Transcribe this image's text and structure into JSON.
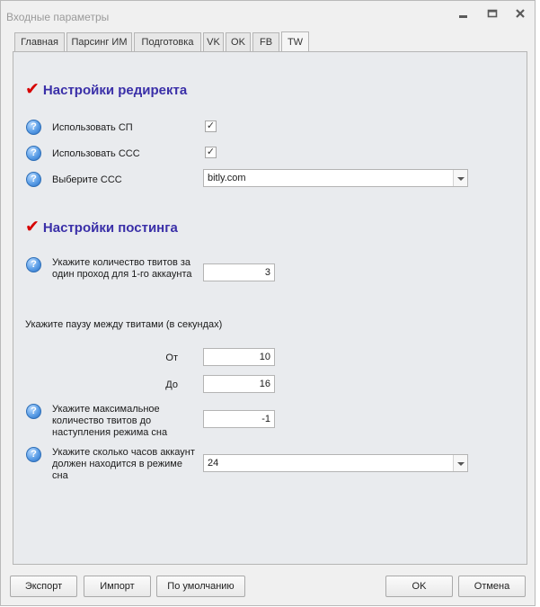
{
  "window": {
    "title": "Входные параметры"
  },
  "tabs": [
    {
      "label": "Главная"
    },
    {
      "label": "Парсинг ИМ"
    },
    {
      "label": "Подготовка"
    },
    {
      "label": "VK"
    },
    {
      "label": "OK"
    },
    {
      "label": "FB"
    },
    {
      "label": "TW",
      "active": true
    }
  ],
  "redirect": {
    "heading": "Настройки редиректа",
    "use_sp": {
      "label": "Использовать СП",
      "checked": true
    },
    "use_sss": {
      "label": "Использовать ССС",
      "checked": true
    },
    "choose_sss": {
      "label": "Выберите ССС",
      "value": "bitly.com"
    }
  },
  "posting": {
    "heading": "Настройки постинга",
    "tweets_per_pass": {
      "label": "Укажите количество твитов за один проход для 1-го аккаунта",
      "value": "3"
    },
    "pause_label": "Укажите паузу между твитами (в секундах)",
    "from": {
      "label": "От",
      "value": "10"
    },
    "to": {
      "label": "До",
      "value": "16"
    },
    "max_tweets": {
      "label": "Укажите максимальное количество твитов до наступления режима сна",
      "value": "-1"
    },
    "sleep_hours": {
      "label": "Укажите сколько часов аккаунт должен находится в режиме сна",
      "value": "24"
    }
  },
  "buttons": {
    "export": "Экспорт",
    "import": "Импорт",
    "defaults": "По умолчанию",
    "ok": "OK",
    "cancel": "Отмена"
  },
  "icons": {
    "help": "help-icon",
    "check": "check-icon",
    "minimize": "minimize-icon",
    "maximize": "maximize-icon",
    "close": "close-icon"
  },
  "colors": {
    "heading": "#3a2fa8",
    "checkmark": "#d60000",
    "panel": "#e9ebee"
  }
}
